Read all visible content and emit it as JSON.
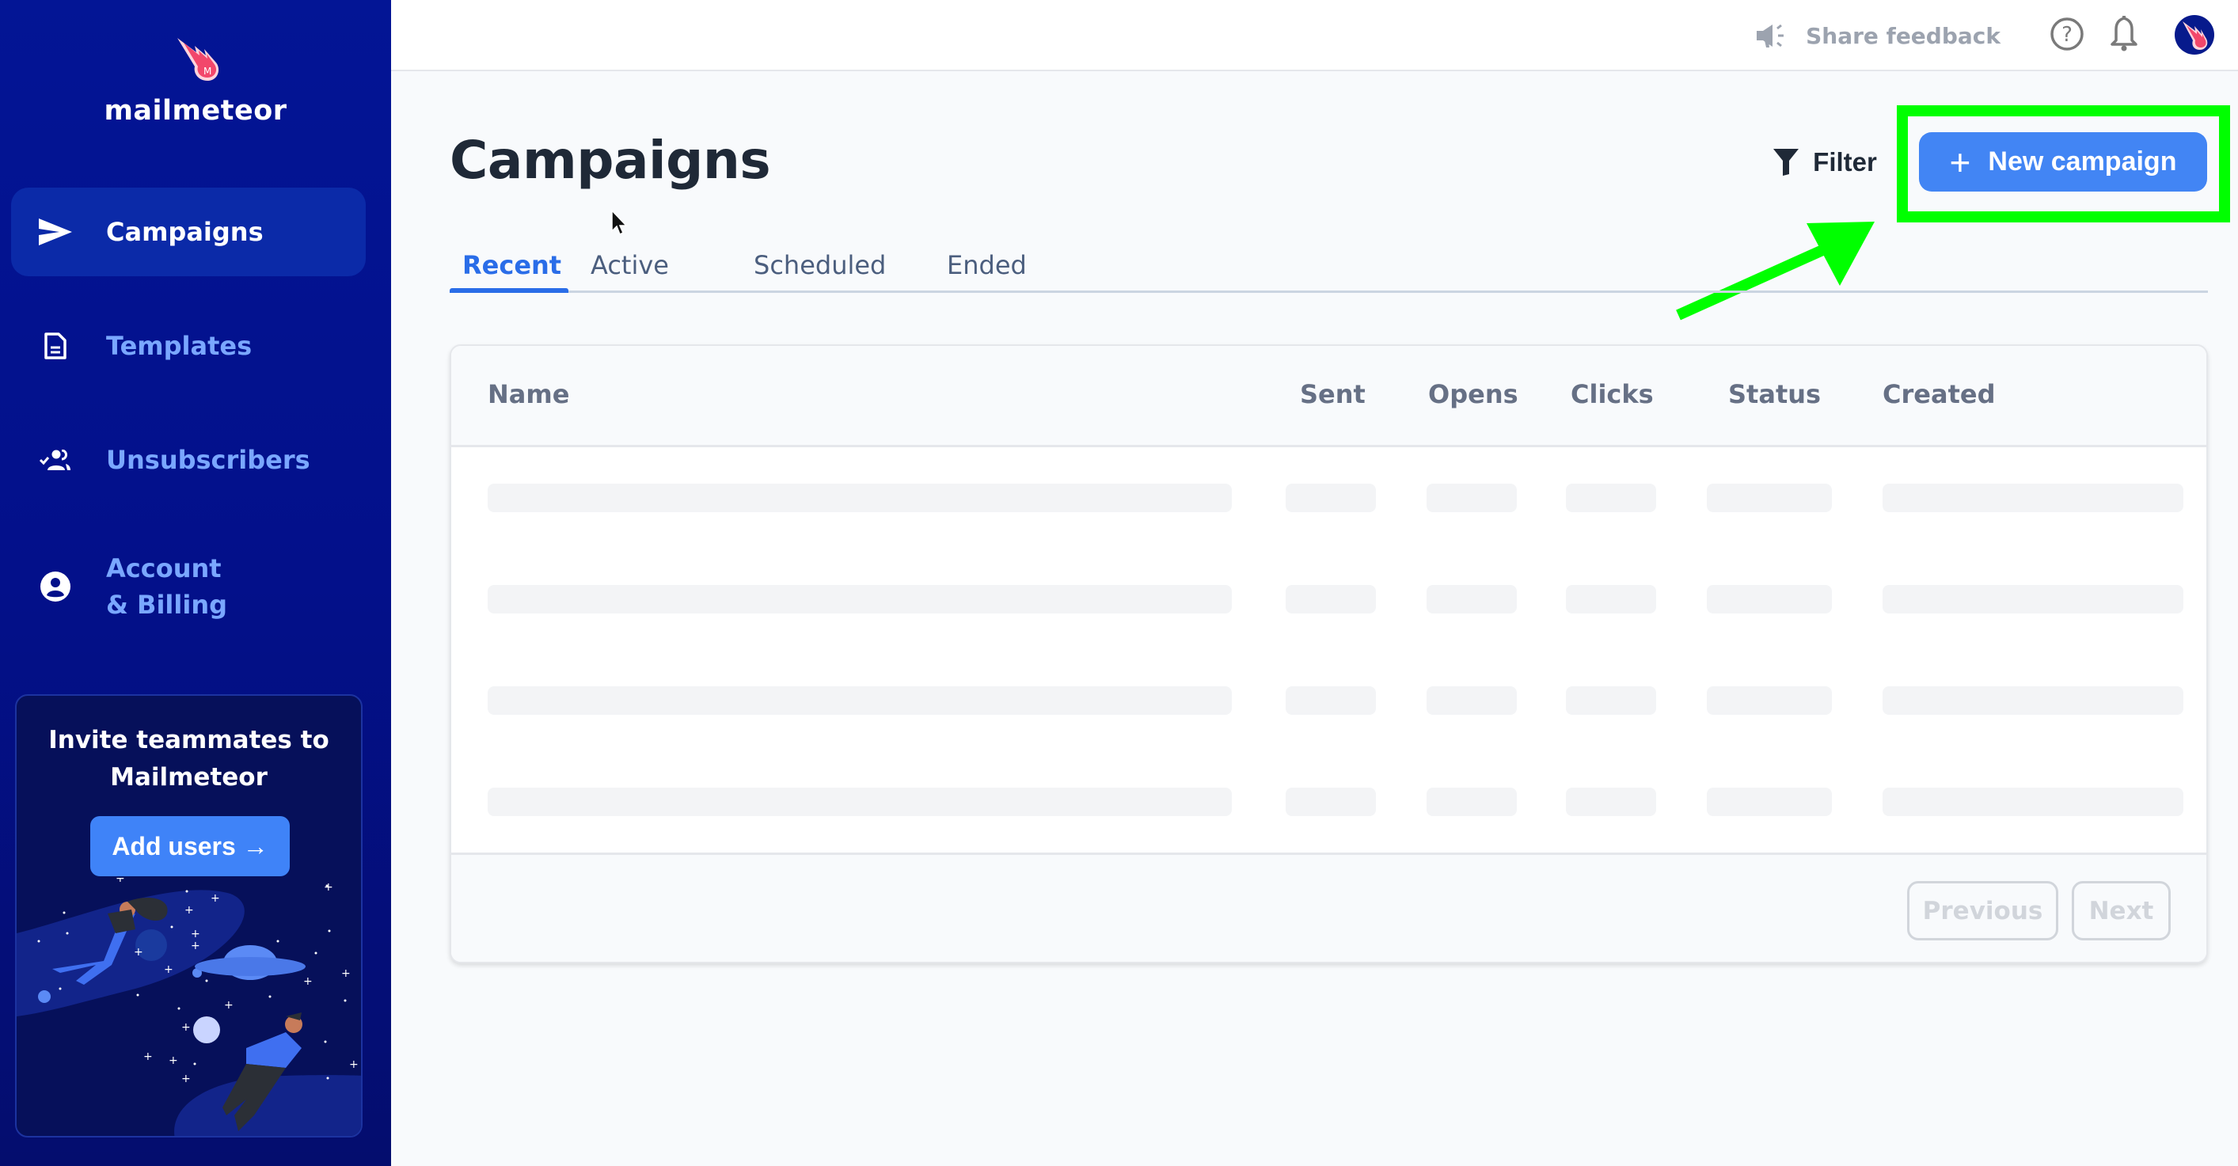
{
  "sidebar": {
    "brand": "mailmeteor",
    "items": [
      {
        "label": "Campaigns",
        "icon": "send-icon",
        "active": true
      },
      {
        "label": "Templates",
        "icon": "document-icon",
        "active": false
      },
      {
        "label": "Unsubscribers",
        "icon": "users-check-icon",
        "active": false
      },
      {
        "label": "Account\n& Billing",
        "label_line1": "Account",
        "label_line2": "& Billing",
        "icon": "account-circle-icon",
        "active": false
      }
    ],
    "invite": {
      "title_line1": "Invite teammates to",
      "title_line2": "Mailmeteor",
      "button_label": "Add users →"
    }
  },
  "topbar": {
    "feedback_label": "Share feedback",
    "icons": [
      "megaphone-icon",
      "help-icon",
      "bell-icon",
      "avatar"
    ]
  },
  "main": {
    "title": "Campaigns",
    "filter_label": "Filter",
    "new_campaign_label": "New campaign",
    "tabs": [
      {
        "label": "Recent",
        "active": true
      },
      {
        "label": "Active",
        "active": false
      },
      {
        "label": "Scheduled",
        "active": false
      },
      {
        "label": "Ended",
        "active": false
      }
    ],
    "table": {
      "columns": [
        "Name",
        "Sent",
        "Opens",
        "Clicks",
        "Status",
        "Created"
      ],
      "loading_rows": 4
    },
    "pagination": {
      "previous_label": "Previous",
      "next_label": "Next"
    }
  },
  "annotation": {
    "highlight_color": "#00ff00",
    "target": "New campaign"
  },
  "colors": {
    "sidebar_bg": "#031595",
    "accent": "#4285f4",
    "active_tab": "#2a6de8",
    "nav_inactive": "#7aa7ff"
  }
}
